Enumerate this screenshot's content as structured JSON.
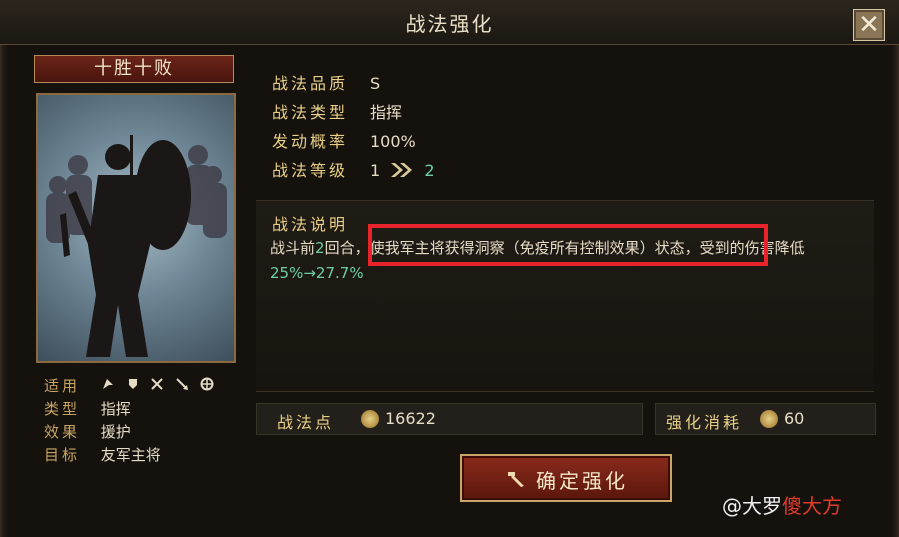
{
  "window": {
    "title": "战法强化",
    "close_label": "✕"
  },
  "card": {
    "name": "十胜十败"
  },
  "props": [
    {
      "label": "适用",
      "value": ""
    },
    {
      "label": "类型",
      "value": "指挥"
    },
    {
      "label": "效果",
      "value": "援护"
    },
    {
      "label": "目标",
      "value": "友军主将"
    }
  ],
  "applicable_icons": [
    "cavalry-icon",
    "shield-icon",
    "crossbow-icon",
    "spear-icon",
    "wheel-icon"
  ],
  "info": {
    "quality_label": "战法品质",
    "quality": "S",
    "type_label": "战法类型",
    "type": "指挥",
    "prob_label": "发动概率",
    "prob": "100%",
    "level_label": "战法等级",
    "level_from": "1",
    "level_to": "2"
  },
  "desc": {
    "title": "战法说明",
    "p1": "战斗前",
    "rounds": "2",
    "p2": "回合，使我军主将获得洞察（免疫所有控制效果）状态，受到的伤害降低",
    "from": "25%",
    "arrow": "→",
    "to": "27.7%"
  },
  "points": {
    "label": "战法点",
    "value": "16622"
  },
  "cost": {
    "label": "强化消耗",
    "value": "60"
  },
  "confirm": {
    "label": "确定强化"
  },
  "watermark": {
    "a": "@大罗",
    "b": "傻大方"
  }
}
